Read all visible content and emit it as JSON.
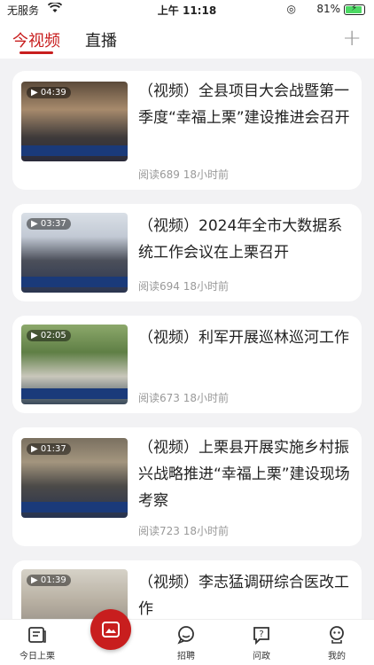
{
  "status_bar": {
    "carrier": "无服务",
    "time": "上午 11:18",
    "battery": "81%"
  },
  "top_nav": {
    "tabs": [
      {
        "label": "今视频",
        "active": true
      },
      {
        "label": "直播",
        "active": false
      }
    ],
    "add_icon": "plus-icon"
  },
  "feed": {
    "items": [
      {
        "duration": "04:39",
        "title": "（视频）全县项目大会战暨第一季度“幸福上栗”建设推进会召开",
        "reads": "阅读689",
        "time": "18小时前"
      },
      {
        "duration": "03:37",
        "title": "（视频）2024年全市大数据系统工作会议在上栗召开",
        "reads": "阅读694",
        "time": "18小时前"
      },
      {
        "duration": "02:05",
        "title": "（视频）利军开展巡林巡河工作",
        "reads": "阅读673",
        "time": "18小时前"
      },
      {
        "duration": "01:37",
        "title": "（视频）上栗县开展实施乡村振兴战略推进“幸福上栗”建设现场考察",
        "reads": "阅读723",
        "time": "18小时前"
      },
      {
        "duration": "01:39",
        "title": "（视频）李志猛调研综合医改工作",
        "reads": "",
        "time": ""
      }
    ]
  },
  "bottom_tabs": [
    {
      "label": "今日上栗",
      "icon": "news-icon"
    },
    {
      "label": "",
      "icon": "video-icon"
    },
    {
      "label": "招聘",
      "icon": "chat-icon"
    },
    {
      "label": "问政",
      "icon": "question-icon"
    },
    {
      "label": "我的",
      "icon": "profile-icon"
    }
  ],
  "colors": {
    "accent": "#c81e1e",
    "muted": "#999999"
  }
}
